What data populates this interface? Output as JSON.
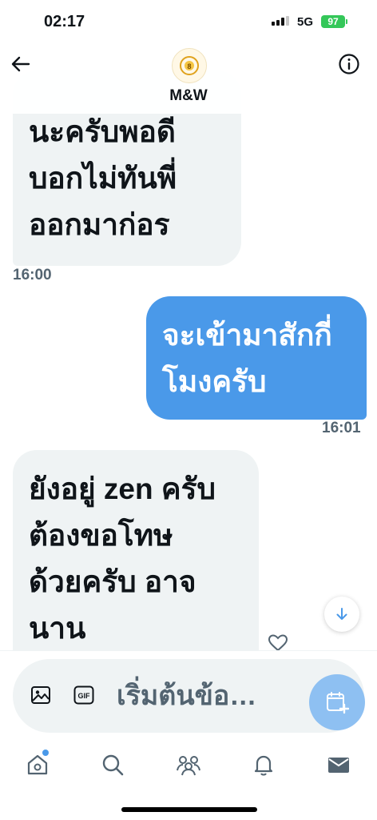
{
  "status_bar": {
    "time": "02:17",
    "network": "5G",
    "battery": "97"
  },
  "header": {
    "contact_name": "M&W"
  },
  "messages": [
    {
      "direction": "incoming",
      "text": "นะครับพอดี\nบอกไม่ทันพี่\nออกมาก่อร",
      "time": "16:00"
    },
    {
      "direction": "outgoing",
      "text": "จะเข้ามาสักกี่\nโมงครับ",
      "time": "16:01"
    },
    {
      "direction": "incoming",
      "text": "ยังอยู่ zen ครับ\nต้องขอโทษ\nด้วยครับ อาจ\nนาน",
      "time": ""
    }
  ],
  "composer": {
    "placeholder": "เริ่มต้นข้อ…",
    "gif_label": "GIF"
  },
  "icons": {
    "back": "arrow-left-icon",
    "info": "info-icon",
    "image": "image-icon",
    "gif": "gif-icon",
    "send": "calendar-add-icon",
    "scroll": "arrow-down-icon",
    "react": "heart-icon"
  },
  "tabs": [
    "home",
    "search",
    "communities",
    "notifications",
    "messages"
  ],
  "colors": {
    "outgoing_bubble": "#4a99e9",
    "incoming_bubble": "#eff3f4",
    "battery": "#34c759",
    "accent": "#4a99e9"
  }
}
